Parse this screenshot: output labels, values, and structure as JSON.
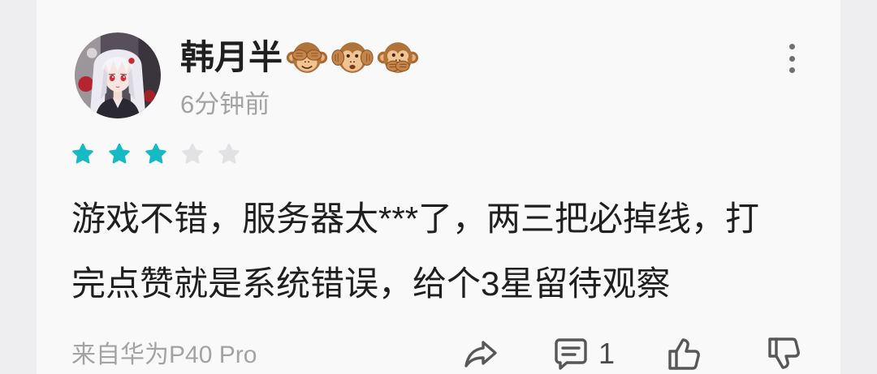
{
  "review": {
    "user": {
      "name": "韩月半",
      "name_emojis": [
        "see-no-evil-monkey-icon",
        "hear-no-evil-monkey-icon",
        "speak-no-evil-monkey-icon"
      ]
    },
    "time": "6分钟前",
    "more_icon": "more-vertical-icon",
    "rating": 3,
    "rating_max": 5,
    "text_lines": [
      "游戏不错，服务器太***了，两三把必掉线，打",
      "完点赞就是系统错误，给个3星留待观察"
    ],
    "device": "来自华为P40 Pro",
    "actions": {
      "share_icon": "share-icon",
      "comment_icon": "comment-icon",
      "comment_count": "1",
      "like_icon": "thumbs-up-icon",
      "dislike_icon": "thumbs-down-icon"
    }
  },
  "colors": {
    "star_filled": "#15bac4",
    "star_empty": "#e2e2e4",
    "text_primary": "#1f1f1f",
    "text_secondary": "#a3a3a3"
  }
}
